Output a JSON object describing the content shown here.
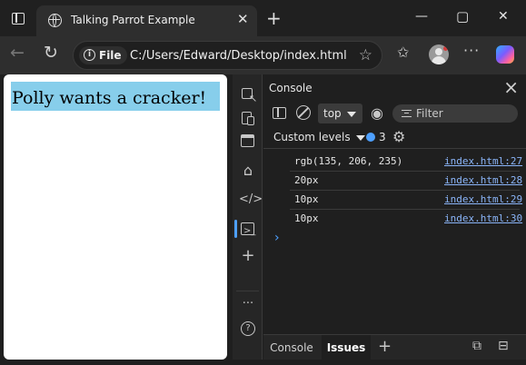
{
  "tab": {
    "title": "Talking Parrot Example",
    "close_glyph": "✕"
  },
  "window_controls": {
    "minimize": "—",
    "maximize": "▢",
    "close": "✕"
  },
  "toolbar": {
    "new_tab_glyph": "+",
    "scheme_label": "File",
    "url": "C:/Users/Edward/Desktop/index.html"
  },
  "page": {
    "parrot_text": "Polly wants a cracker!",
    "parrot_bg": "#87ceeb"
  },
  "devtools": {
    "panel_title": "Console",
    "context_select": "top",
    "filter_placeholder": "Filter",
    "levels_label": "Custom levels",
    "issues_count": "3",
    "logs": [
      {
        "message": "rgb(135, 206, 235)",
        "source": "index.html:27"
      },
      {
        "message": "20px",
        "source": "index.html:28"
      },
      {
        "message": "10px",
        "source": "index.html:29"
      },
      {
        "message": "10px",
        "source": "index.html:30"
      }
    ],
    "prompt_glyph": "›",
    "drawer_tabs": [
      "Console",
      "Issues"
    ],
    "accent": "#4ea0ff",
    "link_color": "#8ab4f8"
  }
}
